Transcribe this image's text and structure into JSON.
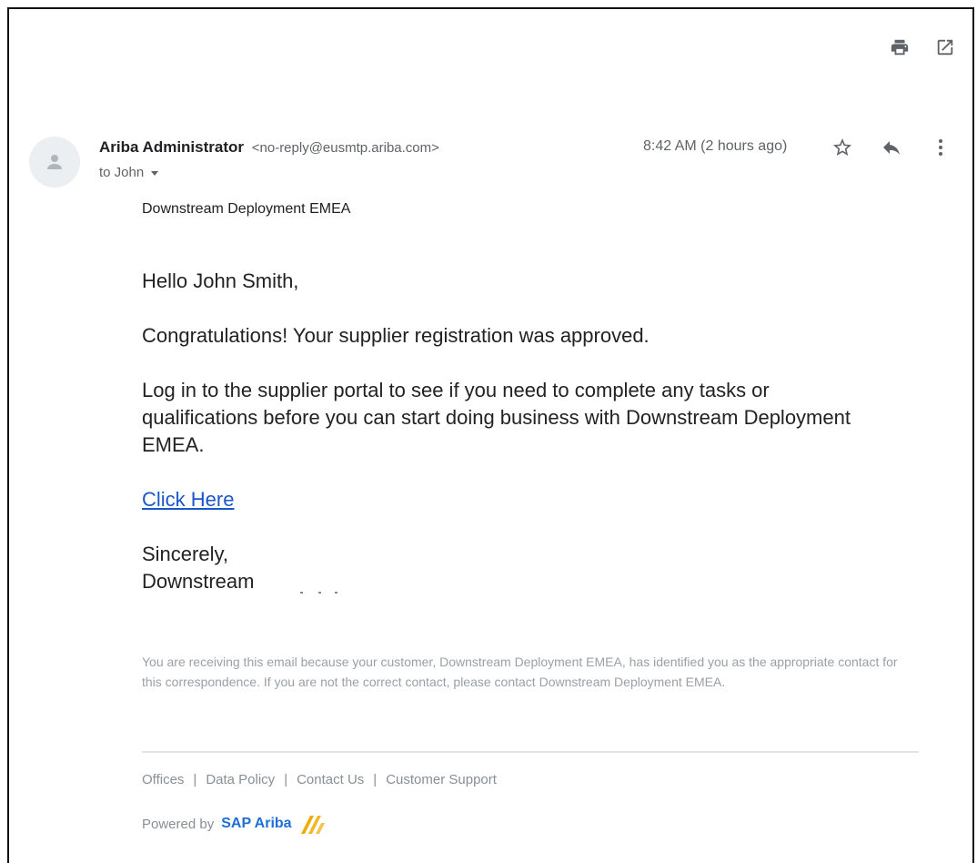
{
  "header": {
    "icons": [
      "printer-icon",
      "open-in-new-window-icon"
    ]
  },
  "message": {
    "sender_name": "Ariba Administrator",
    "sender_email": "<no-reply@eusmtp.ariba.com>",
    "recipient": "to John",
    "timestamp": "8:42 AM (2 hours ago)",
    "actions": [
      "star-icon",
      "reply-icon",
      "more-vert-icon"
    ]
  },
  "body": {
    "org_line": "Downstream Deployment EMEA",
    "greeting": "Hello John Smith,",
    "congrats": "Congratulations! Your supplier registration was approved.",
    "instructions": "Log in to the supplier portal to see if you need to complete any tasks or qualifications before you can start doing business with Downstream Deployment EMEA.",
    "link": "Click Here",
    "signoff": "Sincerely,",
    "signer": "Downstream Deployment EMEA"
  },
  "footer": {
    "notice": "You are receiving this email because your customer, Downstream Deployment EMEA, has identified you as the appropriate contact for this correspondence. If you are not the correct contact, please contact Downstream Deployment EMEA.",
    "links": [
      "Offices",
      "Data Policy",
      "Contact Us",
      "Customer Support"
    ],
    "separator": "|",
    "powered_by": "Powered by",
    "brand": "SAP Ariba"
  },
  "colors": {
    "link": "#1a57c8",
    "brand_blue": "#1d6fd6",
    "brand_mark": "#f0ab00",
    "muted_text": "#9aa0a6"
  }
}
